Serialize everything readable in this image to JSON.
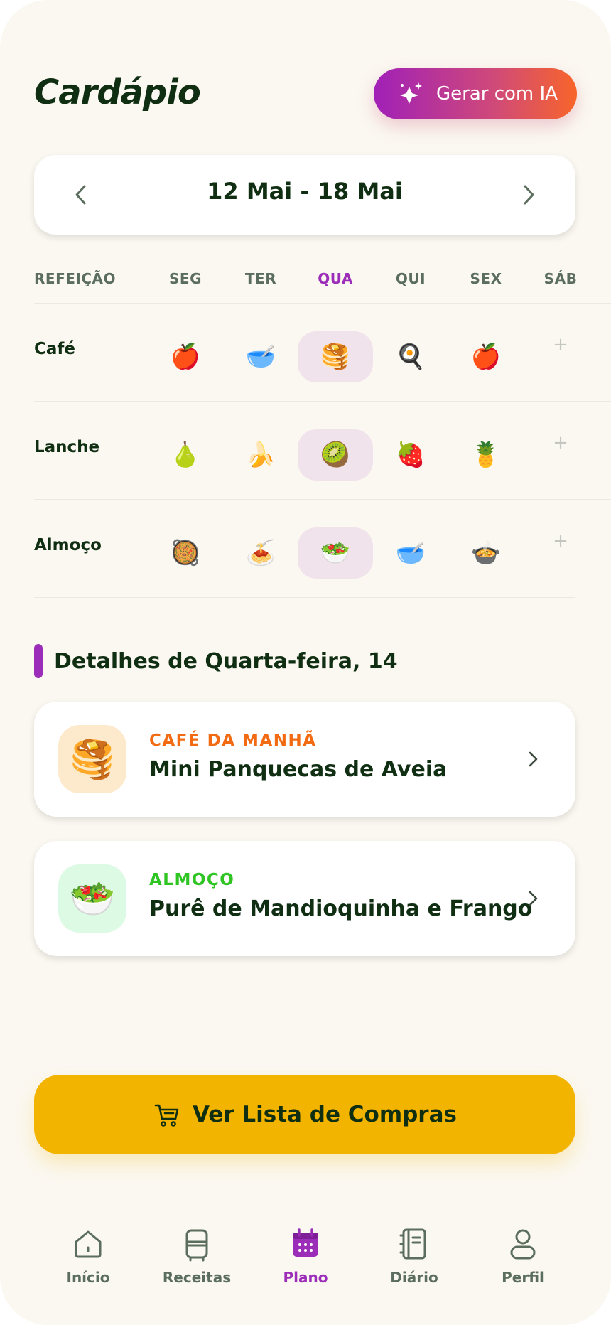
{
  "header": {
    "title": "Cardápio",
    "ai_button": {
      "label": "Gerar com IA",
      "icon": "sparkle-icon"
    }
  },
  "week": {
    "range": "12 Mai - 18 Mai",
    "prev_icon": "chevron-left-icon",
    "next_icon": "chevron-right-icon"
  },
  "grid": {
    "meal_header": "REFEIÇÃO",
    "days": [
      {
        "label": "SEG",
        "active": false
      },
      {
        "label": "TER",
        "active": false
      },
      {
        "label": "QUA",
        "active": true
      },
      {
        "label": "QUI",
        "active": false
      },
      {
        "label": "SEX",
        "active": false
      },
      {
        "label": "SÁB",
        "active": false
      }
    ],
    "rows": [
      {
        "meal": "Café",
        "items": [
          "🍎",
          "🥣",
          "🥞",
          "🍳",
          "🍎",
          "+"
        ]
      },
      {
        "meal": "Lanche",
        "items": [
          "🍐",
          "🍌",
          "🥝",
          "🍓",
          "🍍",
          "+"
        ]
      },
      {
        "meal": "Almoço",
        "items": [
          "🥘",
          "🍝",
          "🥗",
          "🥣",
          "🍲",
          "+"
        ]
      }
    ]
  },
  "details": {
    "title": "Detalhes de Quarta-feira, 14",
    "cards": [
      {
        "category": "CAFÉ DA MANHÃ",
        "name": "Mini Panquecas de Aveia",
        "emoji": "🥞",
        "category_color": "#f26b12",
        "thumb_bg": "#fde9cc"
      },
      {
        "category": "ALMOÇO",
        "name": "Purê de Mandioquinha e Frango",
        "emoji": "🥗",
        "category_color": "#2ec422",
        "thumb_bg": "#dcfae4"
      }
    ]
  },
  "shopping_button": {
    "label": "Ver Lista de Compras",
    "icon": "cart-icon"
  },
  "bottom_nav": {
    "items": [
      {
        "label": "Início",
        "icon": "home-icon",
        "active": false
      },
      {
        "label": "Receitas",
        "icon": "fridge-icon",
        "active": false
      },
      {
        "label": "Plano",
        "icon": "calendar-icon",
        "active": true
      },
      {
        "label": "Diário",
        "icon": "journal-icon",
        "active": false
      },
      {
        "label": "Perfil",
        "icon": "user-icon",
        "active": false
      }
    ]
  },
  "colors": {
    "accent": "#9b2db8",
    "primary_text": "#0f2e12",
    "muted": "#5b6e5d",
    "yellow": "#f3b400",
    "background": "#fbf8f1"
  }
}
